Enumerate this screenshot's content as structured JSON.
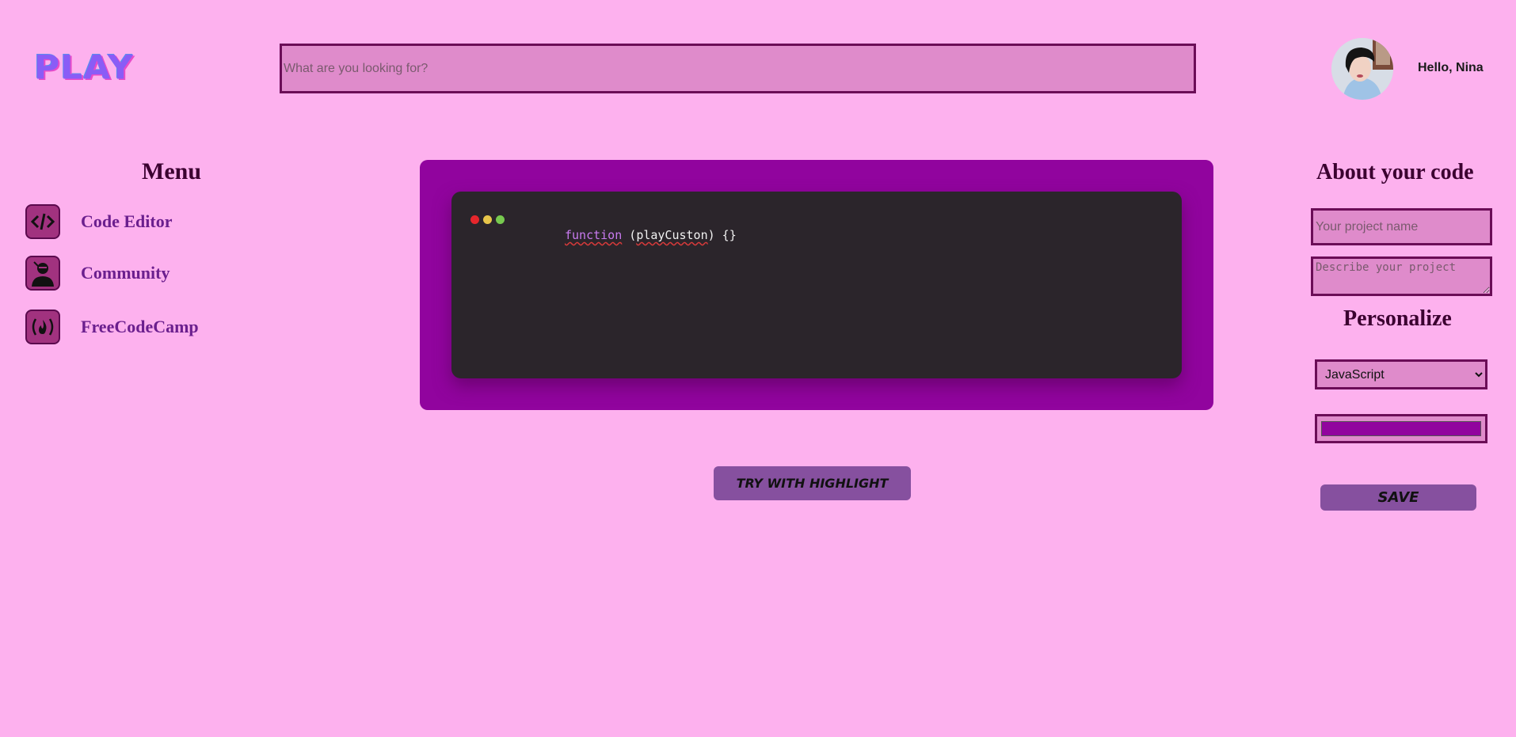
{
  "header": {
    "logo_text": "PLAY",
    "search_placeholder": "What are you looking for?",
    "greeting": "Hello, Nina"
  },
  "menu": {
    "title": "Menu",
    "items": [
      {
        "label": "Code Editor",
        "icon": "code-icon"
      },
      {
        "label": "Community",
        "icon": "user-icon"
      },
      {
        "label": "FreeCodeCamp",
        "icon": "fire-icon"
      }
    ]
  },
  "editor": {
    "code_keyword": "function",
    "code_rest_prefix": " (",
    "code_identifier": "playCuston",
    "code_rest_suffix": ") {}",
    "window_dot_colors": [
      "#E6262C",
      "#E7C54A",
      "#77C94F"
    ],
    "frame_color": "#91049E"
  },
  "actions": {
    "highlight_button": "TRY WITH HIGHLIGHT",
    "save_button": "SAVE"
  },
  "about": {
    "title": "About your code",
    "name_placeholder": "Your project name",
    "description_placeholder": "Describe your project"
  },
  "personalize": {
    "title": "Personalize",
    "language_selected": "JavaScript",
    "color_value": "#91049E"
  }
}
